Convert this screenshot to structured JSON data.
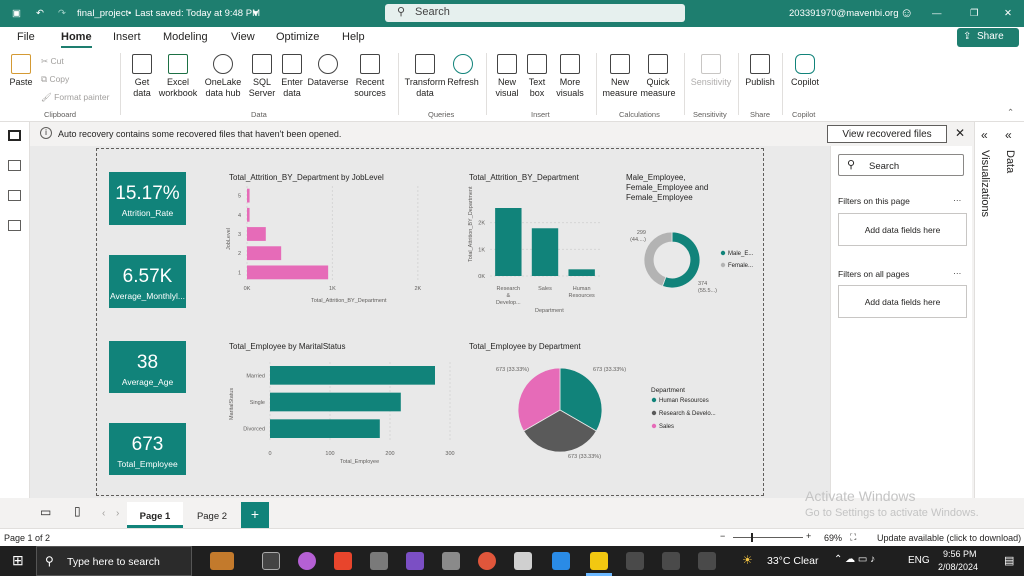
{
  "titlebar": {
    "file_name": "final_project",
    "saved": "Last saved: Today at 9:48 PM",
    "search": "Search",
    "account": "203391970@mavenbi.org"
  },
  "menu": [
    "File",
    "Home",
    "Insert",
    "Modeling",
    "View",
    "Optimize",
    "Help"
  ],
  "share": "Share",
  "ribbon": {
    "clipboard": {
      "paste": "Paste",
      "cut": "Cut",
      "copy": "Copy",
      "format_painter": "Format painter",
      "group": "Clipboard"
    },
    "data": {
      "get_data": "Get data",
      "excel": "Excel workbook",
      "onelake": "OneLake data hub",
      "sql": "SQL Server",
      "enter": "Enter data",
      "dataverse": "Dataverse",
      "recent": "Recent sources",
      "group": "Data"
    },
    "queries": {
      "transform": "Transform data",
      "refresh": "Refresh",
      "group": "Queries"
    },
    "insert": {
      "new_visual": "New visual",
      "text_box": "Text box",
      "more_visuals": "More visuals",
      "group": "Insert"
    },
    "calculations": {
      "new_measure": "New measure",
      "quick_measure": "Quick measure",
      "group": "Calculations"
    },
    "sensitivity": {
      "label": "Sensitivity",
      "group": "Sensitivity"
    },
    "share_group": {
      "publish": "Publish",
      "group": "Share"
    },
    "copilot": {
      "label": "Copilot",
      "group": "Copilot"
    }
  },
  "notification": {
    "message": "Auto recovery contains some recovered files that haven't been opened.",
    "button": "View recovered files"
  },
  "cards": [
    {
      "value": "15.17%",
      "label": "Attrition_Rate"
    },
    {
      "value": "6.57K",
      "label": "Average_Monthlyl..."
    },
    {
      "value": "38",
      "label": "Average_Age"
    },
    {
      "value": "673",
      "label": "Total_Employee"
    }
  ],
  "chart_data": [
    {
      "type": "bar",
      "orientation": "horizontal",
      "title": "Total_Attrition_BY_Department by JobLevel",
      "ylabel": "JobLevel",
      "xlabel": "Total_Attrition_BY_Department",
      "categories": [
        "5",
        "4",
        "3",
        "2",
        "1"
      ],
      "values": [
        30,
        30,
        220,
        400,
        950
      ],
      "xlim": [
        0,
        2400
      ],
      "xticks": [
        "0K",
        "1K",
        "2K"
      ],
      "color": "#e66bb8"
    },
    {
      "type": "bar",
      "title": "Total_Attrition_BY_Department",
      "ylabel": "Total_Attrition_BY_Department",
      "xlabel": "Department",
      "categories": [
        "Research & Develop...",
        "Sales",
        "Human Resources"
      ],
      "values": [
        2550,
        1790,
        250
      ],
      "ylim": [
        0,
        3000
      ],
      "yticks": [
        "0K",
        "1K",
        "2K"
      ],
      "color": "#11837a"
    },
    {
      "type": "pie",
      "donut": true,
      "title": "Male_Employee, Female_Employee and Female_Employee",
      "slices": [
        {
          "name": "Male_E...",
          "value": 374,
          "label": "374 (55.5...)",
          "color": "#11837a"
        },
        {
          "name": "Female...",
          "value": 299,
          "label": "299 (44....)",
          "color": "#b3b3b3"
        }
      ]
    },
    {
      "type": "bar",
      "orientation": "horizontal",
      "title": "Total_Employee by MaritalStatus",
      "ylabel": "MaritalStatus",
      "xlabel": "Total_Employee",
      "categories": [
        "Married",
        "Single",
        "Divorced"
      ],
      "values": [
        275,
        218,
        183
      ],
      "xlim": [
        0,
        300
      ],
      "xticks": [
        "0",
        "100",
        "200",
        "300"
      ],
      "color": "#11837a"
    },
    {
      "type": "pie",
      "title": "Total_Employee by Department",
      "legend_title": "Department",
      "slices": [
        {
          "name": "Human Resources",
          "value": 673,
          "label": "673 (33.33%)",
          "color": "#11837a"
        },
        {
          "name": "Research & Develo...",
          "value": 673,
          "label": "673 (33.33%)",
          "color": "#5a5a5a"
        },
        {
          "name": "Sales",
          "value": 673,
          "label": "673 (33.33%)",
          "color": "#e66bb8"
        }
      ]
    }
  ],
  "filters": {
    "search": "Search",
    "on_page": "Filters on this page",
    "add1": "Add data fields here",
    "all_pages": "Filters on all pages",
    "add2": "Add data fields here"
  },
  "rightbar": {
    "viz": "Visualizations",
    "data": "Data"
  },
  "pages": [
    "Page 1",
    "Page 2"
  ],
  "watermark": {
    "line1": "Activate Windows",
    "line2": "Go to Settings to activate Windows."
  },
  "status": {
    "page": "Page 1 of 2",
    "zoom": "69%",
    "update": "Update available (click to download)"
  },
  "taskbar": {
    "search": "Type here to search",
    "weather": "33°C  Clear",
    "lang": "ENG",
    "time": "9:56 PM",
    "date": "2/08/2024"
  }
}
